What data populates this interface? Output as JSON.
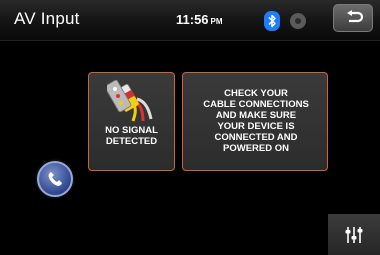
{
  "header": {
    "title": "AV Input",
    "time": "11:56",
    "ampm": "PM"
  },
  "status_icons": [
    "bluetooth-icon",
    "disc-icon"
  ],
  "signal_panel": {
    "text": "NO SIGNAL\nDETECTED",
    "icon": "cable-connector-icon"
  },
  "message_panel": {
    "text": "CHECK YOUR\nCABLE CONNECTIONS\nAND MAKE SURE\nYOUR DEVICE IS\nCONNECTED AND\nPOWERED ON"
  },
  "buttons": {
    "back_icon": "back-arrow-icon",
    "phone_icon": "phone-icon",
    "settings_icon": "equalizer-icon"
  },
  "colors": {
    "panel_border": "#c8663a",
    "bluetooth": "#1e7cff",
    "phone_button": "#334b95"
  }
}
